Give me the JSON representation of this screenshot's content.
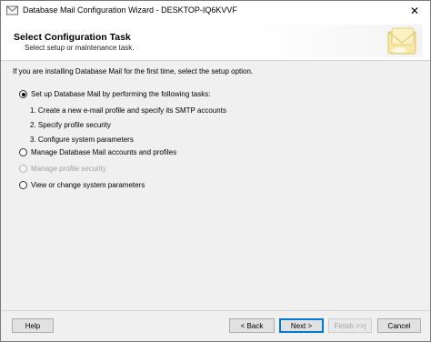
{
  "window": {
    "title": "Database Mail Configuration Wizard - DESKTOP-IQ6KVVF",
    "close_glyph": "✕"
  },
  "header": {
    "title": "Select Configuration Task",
    "subtitle": "Select setup or maintenance task."
  },
  "intro": "If you are installing Database Mail for the first time, select the setup option.",
  "options": [
    {
      "label": "Set up Database Mail by performing the following tasks:",
      "selected": true,
      "enabled": true
    },
    {
      "label": "Manage Database Mail accounts and profiles",
      "selected": false,
      "enabled": true
    },
    {
      "label": "Manage profile security",
      "selected": false,
      "enabled": false
    },
    {
      "label": "View or change system parameters",
      "selected": false,
      "enabled": true
    }
  ],
  "setup_steps": [
    "1. Create a new e-mail profile and specify its SMTP accounts",
    "2. Specify profile security",
    "3. Configure system parameters"
  ],
  "buttons": {
    "help": "Help",
    "back": "< Back",
    "next": "Next >",
    "finish": "Finish >>|",
    "cancel": "Cancel"
  },
  "colors": {
    "focus_border": "#0078d7",
    "disabled_text": "#a0a0a0"
  }
}
